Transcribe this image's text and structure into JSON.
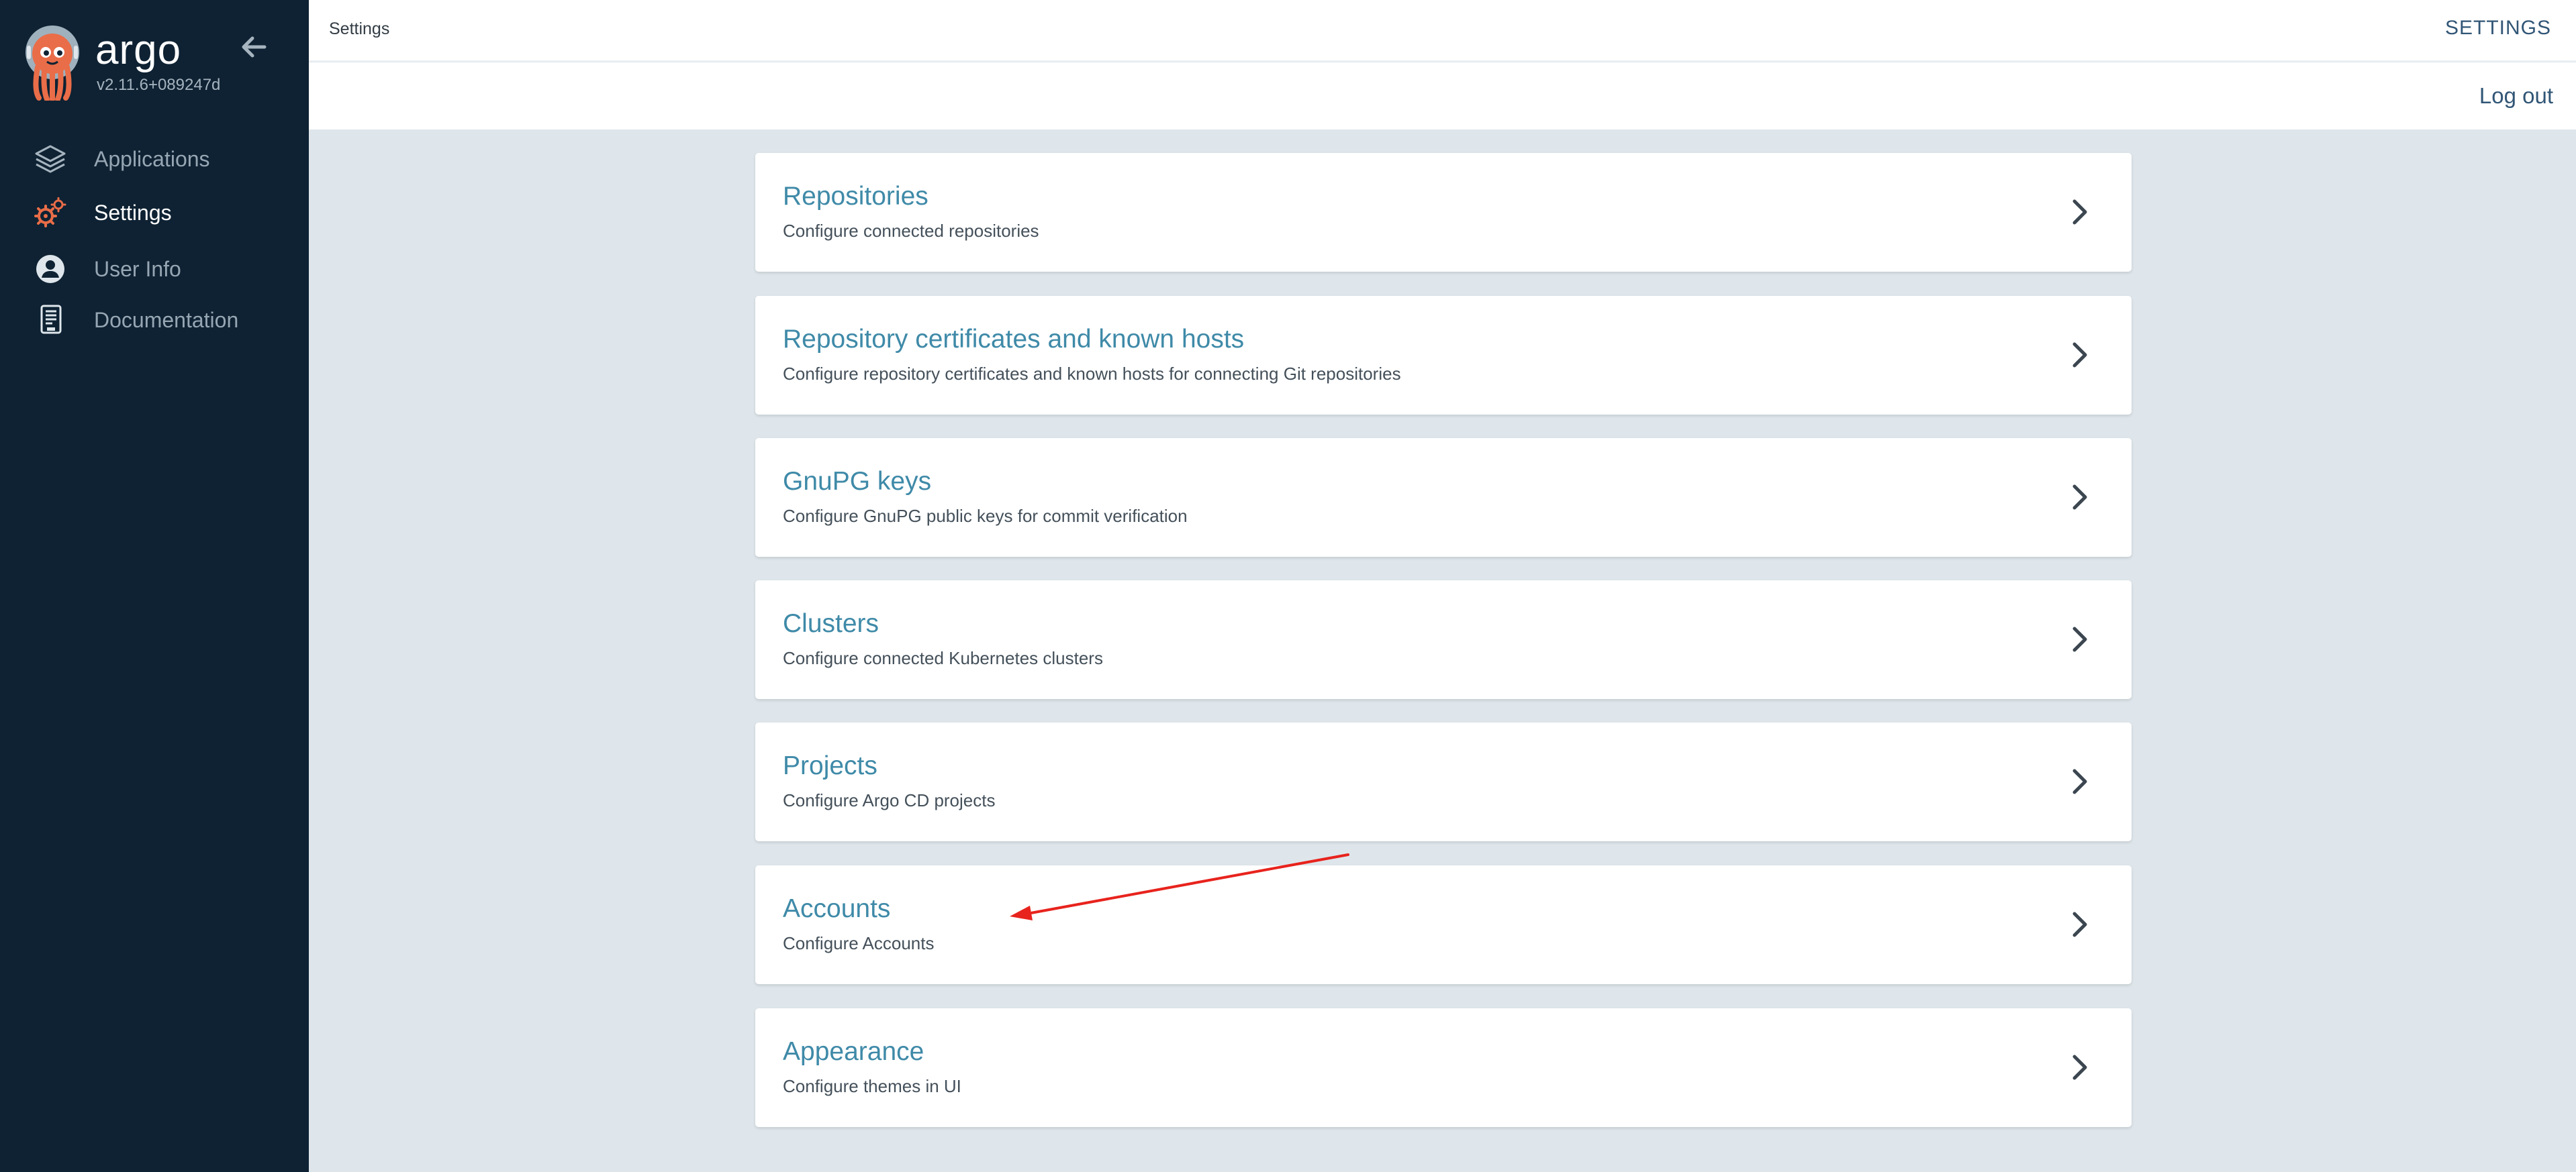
{
  "sidebar": {
    "brand_name": "argo",
    "version": "v2.11.6+089247d",
    "items": [
      {
        "label": "Applications",
        "icon": "layers-icon",
        "active": false
      },
      {
        "label": "Settings",
        "icon": "gears-icon",
        "active": true
      },
      {
        "label": "User Info",
        "icon": "user-circle-icon",
        "active": false
      },
      {
        "label": "Documentation",
        "icon": "book-icon",
        "active": false
      }
    ]
  },
  "header": {
    "breadcrumb": "Settings",
    "title": "SETTINGS",
    "logout_label": "Log out"
  },
  "settings": {
    "items": [
      {
        "title": "Repositories",
        "description": "Configure connected repositories"
      },
      {
        "title": "Repository certificates and known hosts",
        "description": "Configure repository certificates and known hosts for connecting Git repositories"
      },
      {
        "title": "GnuPG keys",
        "description": "Configure GnuPG public keys for commit verification"
      },
      {
        "title": "Clusters",
        "description": "Configure connected Kubernetes clusters"
      },
      {
        "title": "Projects",
        "description": "Configure Argo CD projects"
      },
      {
        "title": "Accounts",
        "description": "Configure Accounts"
      },
      {
        "title": "Appearance",
        "description": "Configure themes in UI"
      }
    ]
  },
  "colors": {
    "sidebar_bg": "#0e2233",
    "content_bg": "#dee6eb",
    "card_title": "#3f8aa8",
    "accent_orange": "#e96d48",
    "annotation_arrow": "#e8231d"
  }
}
